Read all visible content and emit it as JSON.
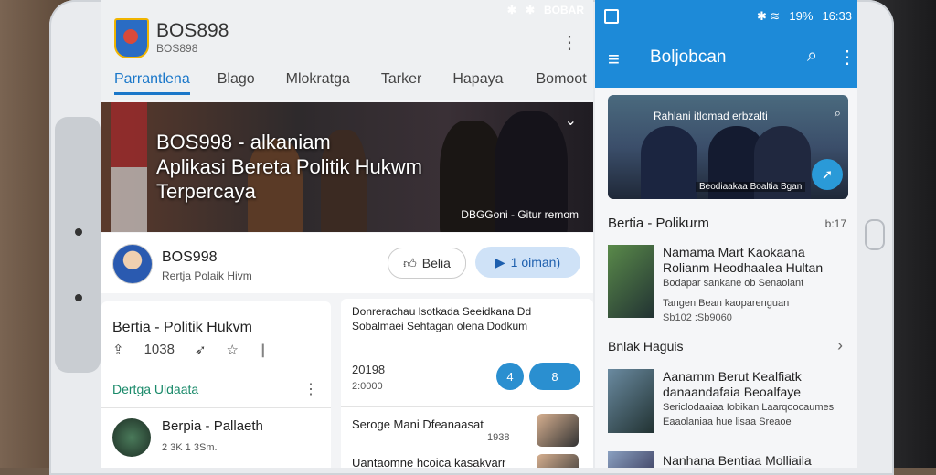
{
  "left": {
    "status": [
      "✱",
      "✱",
      "BOBAR"
    ],
    "brand": {
      "name": "BOS898",
      "sub": "BOS898"
    },
    "tabs": [
      {
        "label": "Parrantlena"
      },
      {
        "label": "Blago"
      },
      {
        "label": "Mlokratga"
      },
      {
        "label": "Tarker"
      },
      {
        "label": "Hapaya"
      },
      {
        "label": "Bomoot"
      }
    ],
    "hero": {
      "line1": "BOS998 - alkaniam",
      "line2": "Aplikasi Bereta Politik Hukwm",
      "line3": "Terpercaya",
      "caption": "DBGGoni - Gitur remom"
    },
    "author": {
      "name": "BOS998",
      "sub": "Rertja Polaik Hivm"
    },
    "buttons": {
      "like": "Belia",
      "follow": "1 oiman)"
    },
    "card1": {
      "title": "Bertia - Politik Hukvm",
      "icons_num": "1038",
      "section": "Dertga Uldaata",
      "item_title": "Berpia - Pallaeth",
      "item_meta": "2 3K 1 3Sm."
    },
    "card2": {
      "text": "Donrerachau lsotkada Seeidkana Dd Sobalmaei Sehtagan olena Dodkum",
      "num1": "20198",
      "num2": "2:0000",
      "btn1": "4",
      "btn2": "8",
      "rows": [
        {
          "title": "Seroge Mani Dfeanaasat",
          "date": "1938"
        },
        {
          "title": "Uantaomne hcoica kasakvarr",
          "date": ""
        }
      ]
    }
  },
  "right": {
    "status": {
      "pct": "19%",
      "time": "16:33",
      "icons": "✱ ≋"
    },
    "appbar": {
      "name": "Boljobcan"
    },
    "hero": {
      "caption": "Rahlani itlomad erbzalti",
      "sub": "Beodiaakaa Boaltia Bgan"
    },
    "section1": {
      "title": "Bertia - Polikurm",
      "right": "b:17"
    },
    "items": [
      {
        "title": "Namama Mart Kaokaana Rolianm Heodhaalea Hultan",
        "meta": "Bodapar sankane ob Senaolant",
        "meta2": "Tangen Bean kaoparenguan",
        "date": "Sb102 :Sb9060"
      },
      {
        "title": "Aanarnm Berut Kealfiatk danaandafaia Beoalfaye",
        "meta": "Sericlodaaiaa Iobikan Laarqoocaumes",
        "meta2": "Eaaolaniaa hue lisaa Sreaoe",
        "date": ""
      },
      {
        "title": "Nanhana Bentiaa Molliaila",
        "meta": "",
        "meta2": "",
        "date": ""
      }
    ],
    "section2": {
      "title": "Bnlak Haguis"
    }
  }
}
